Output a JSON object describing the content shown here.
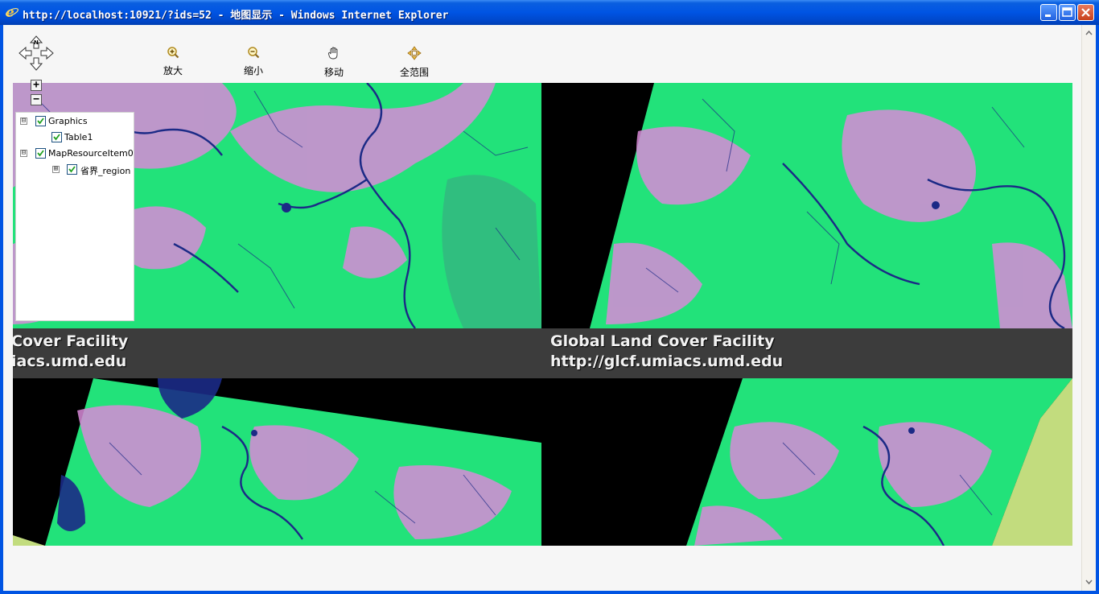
{
  "window": {
    "title": "http://localhost:10921/?ids=52 - 地图显示 - Windows Internet Explorer"
  },
  "toolbar": {
    "tools": [
      {
        "label": "放大",
        "icon": "zoom-in-icon"
      },
      {
        "label": "缩小",
        "icon": "zoom-out-icon"
      },
      {
        "label": "移动",
        "icon": "pan-hand-icon"
      },
      {
        "label": "全范围",
        "icon": "full-extent-icon"
      }
    ]
  },
  "map": {
    "zoom_in_label": "+",
    "zoom_out_label": "−",
    "banner_left": {
      "line1": "Cover Facility",
      "line2": "iacs.umd.edu"
    },
    "banner_right": {
      "line1": "Global Land Cover Facility",
      "line2": "http://glcf.umiacs.umd.edu"
    },
    "colors": {
      "vegetation": "#22e27a",
      "urban": "#d88ad8",
      "water": "#1b2a86",
      "nodata": "#000000",
      "background": "#c2dc7e"
    }
  },
  "toc": {
    "items": [
      {
        "label": "Graphics",
        "expander": "⊟",
        "checked": true
      },
      {
        "label": "Table1",
        "checked": true
      },
      {
        "label": "MapResourceItem0",
        "expander": "⊟",
        "checked": true
      },
      {
        "label": "省界_region",
        "expander": "⊞",
        "checked": true
      }
    ]
  }
}
